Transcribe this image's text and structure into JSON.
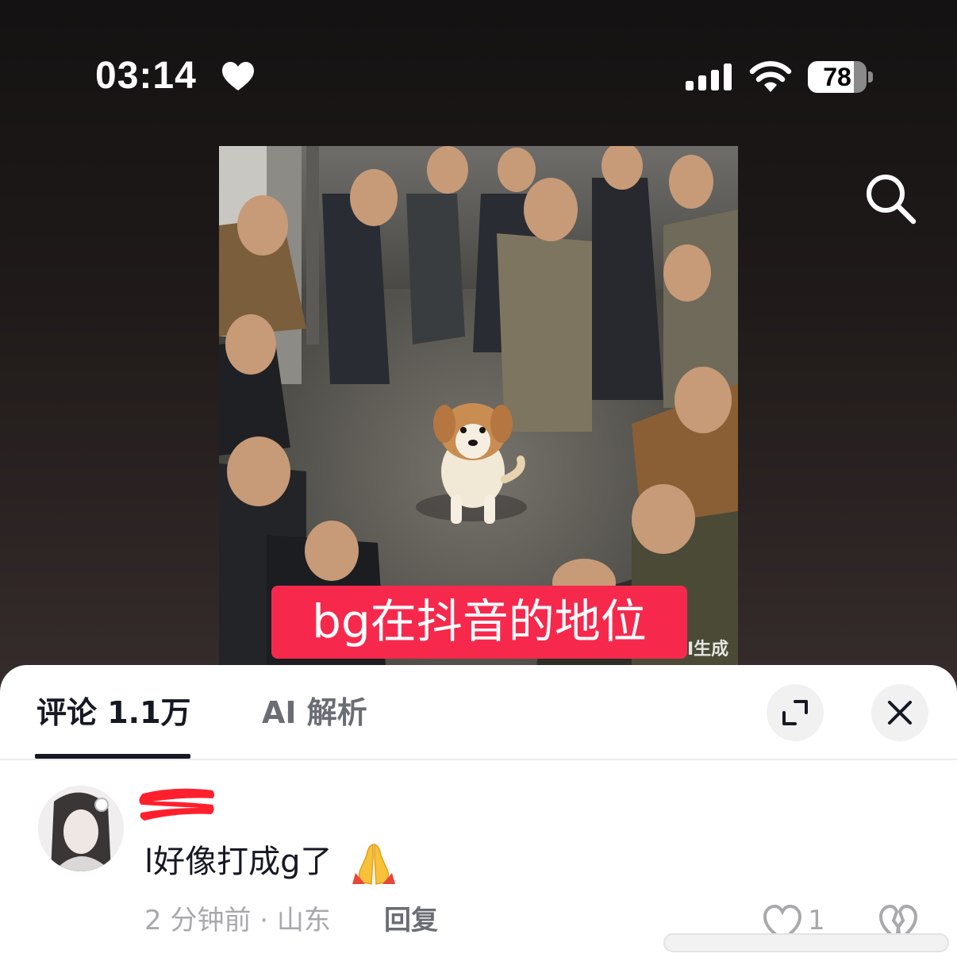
{
  "status_bar": {
    "time": "03:14",
    "battery_level": "78",
    "battery_fraction": 0.78,
    "icons": [
      "heart-icon",
      "cellular-signal-icon",
      "wifi-icon",
      "battery-icon"
    ]
  },
  "header": {
    "search_icon": "search-icon"
  },
  "media": {
    "caption": "bg在抖音的地位",
    "watermark": "AI生成",
    "watermark_visible": "I生成"
  },
  "comment_sheet": {
    "tabs": [
      {
        "label": "评论 1.1万",
        "selected": true
      },
      {
        "label": "AI 解析",
        "selected": false
      }
    ],
    "expand_icon": "expand-icon",
    "close_icon": "close-icon",
    "comments": [
      {
        "avatar": "avatar-image",
        "username": "",
        "text": "l好像打成g了",
        "emoji": "🙏",
        "meta": "2 分钟前 · 山东",
        "reply_label": "回复",
        "like_count": "1"
      }
    ]
  },
  "colors": {
    "caption_bg": "#f6294d",
    "redaction": "#ff1f2d",
    "text_primary": "#161823",
    "text_secondary": "#a8a9ad"
  }
}
